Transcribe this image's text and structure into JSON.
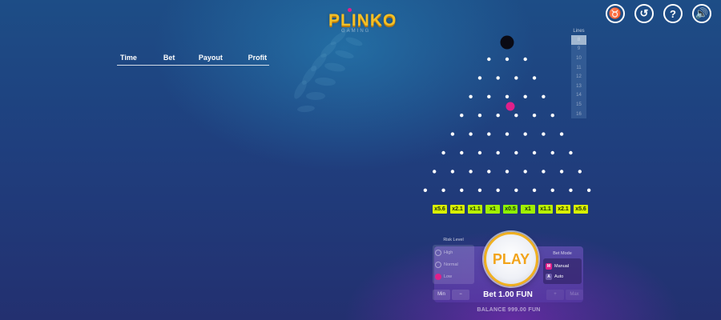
{
  "logo": {
    "title": "PLINKO",
    "subtitle": "GAMING"
  },
  "top_icons": [
    {
      "name": "bull-icon",
      "glyph": "♉"
    },
    {
      "name": "history-icon",
      "glyph": "↺"
    },
    {
      "name": "help-icon",
      "glyph": "?"
    },
    {
      "name": "sound-icon",
      "glyph": "🔊"
    }
  ],
  "history": {
    "columns": [
      "Time",
      "Bet",
      "Payout",
      "Profit"
    ]
  },
  "board": {
    "rows": 8,
    "ball_color": "#e0208a",
    "launcher_color": "#0a0a14"
  },
  "multipliers": [
    {
      "label": "x5.6",
      "color": "#d8f000"
    },
    {
      "label": "x2.1",
      "color": "#d8f000"
    },
    {
      "label": "x1.1",
      "color": "#b8f000"
    },
    {
      "label": "x1",
      "color": "#a0f000"
    },
    {
      "label": "x0.5",
      "color": "#8cf000"
    },
    {
      "label": "x1",
      "color": "#a0f000"
    },
    {
      "label": "x1.1",
      "color": "#b8f000"
    },
    {
      "label": "x2.1",
      "color": "#d8f000"
    },
    {
      "label": "x5.6",
      "color": "#d8f000"
    }
  ],
  "lines": {
    "label": "Lines",
    "options": [
      "8",
      "9",
      "10",
      "11",
      "12",
      "13",
      "14",
      "15",
      "16"
    ],
    "selected": "8"
  },
  "risk": {
    "label": "Risk Level",
    "options": [
      "High",
      "Normal",
      "Low"
    ],
    "selected": "Low"
  },
  "play": {
    "label": "PLAY"
  },
  "mode": {
    "label": "Bet Mode",
    "options": [
      {
        "key": "M",
        "label": "Manual"
      },
      {
        "key": "A",
        "label": "Auto"
      }
    ],
    "selected": "Manual"
  },
  "bet": {
    "min_label": "Min",
    "minus_label": "−",
    "text": "Bet 1.00 FUN",
    "plus_label": "+",
    "max_label": "Max"
  },
  "balance": {
    "text": "BALANCE 999.00 FUN"
  }
}
